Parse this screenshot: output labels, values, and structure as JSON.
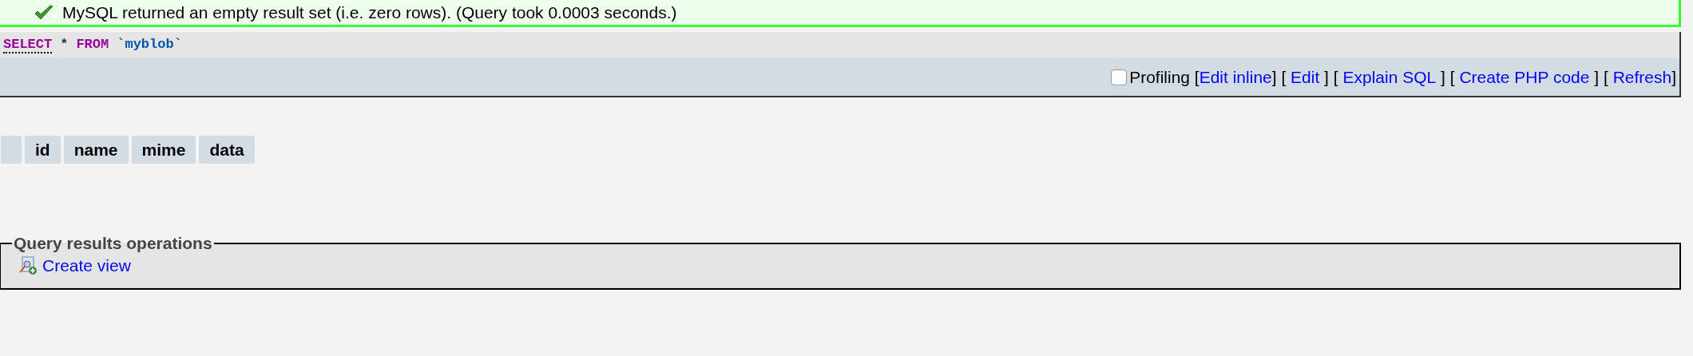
{
  "message": {
    "kind": "success",
    "text": "MySQL returned an empty result set (i.e. zero rows). (Query took 0.0003 seconds.)"
  },
  "sql": {
    "tokens": [
      {
        "kind": "keyword",
        "text": "SELECT",
        "linked": true
      },
      {
        "kind": "operator",
        "text": "*"
      },
      {
        "kind": "keyword",
        "text": "FROM"
      },
      {
        "kind": "identifier",
        "text": "`myblob`"
      }
    ],
    "profiling": {
      "label": "Profiling",
      "checked": false
    },
    "actions": [
      {
        "kind": "text",
        "text": "["
      },
      {
        "kind": "link",
        "text": "Edit inline"
      },
      {
        "kind": "text",
        "text": "] [ "
      },
      {
        "kind": "link",
        "text": "Edit"
      },
      {
        "kind": "text",
        "text": " ] [ "
      },
      {
        "kind": "link",
        "text": "Explain SQL"
      },
      {
        "kind": "text",
        "text": " ] [ "
      },
      {
        "kind": "link",
        "text": "Create PHP code"
      },
      {
        "kind": "text",
        "text": " ] [ "
      },
      {
        "kind": "link",
        "text": "Refresh"
      },
      {
        "kind": "text",
        "text": "]"
      }
    ]
  },
  "table": {
    "columns": [
      "id",
      "name",
      "mime",
      "data"
    ]
  },
  "operations": {
    "legend": "Query results operations",
    "links": [
      "Create view"
    ]
  }
}
